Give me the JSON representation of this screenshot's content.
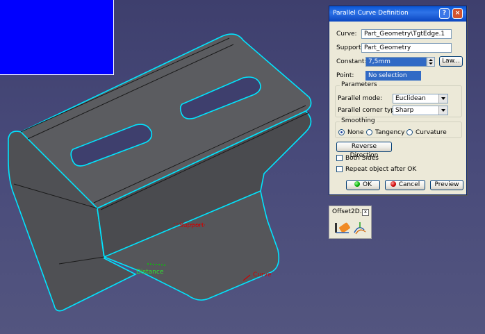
{
  "viewport": {
    "labels": {
      "distance": "Distance",
      "curve": "Curve",
      "support": "Support"
    },
    "colors": {
      "background": "#484a7a",
      "part_fill": "#5a5a5e",
      "edge_highlight": "#00e5ff",
      "compass": "#0000ff"
    }
  },
  "dialog": {
    "title": "Parallel Curve Definition",
    "help_label": "?",
    "close_label": "×",
    "curve": {
      "label": "Curve:",
      "value": "Part_Geometry\\TgtEdge.1"
    },
    "support": {
      "label": "Support:",
      "value": "Part_Geometry"
    },
    "constant": {
      "label": "Constant:",
      "value": "7,5mm",
      "law_button": "Law..."
    },
    "point": {
      "label": "Point:",
      "value": "No selection"
    },
    "parameters": {
      "legend": "Parameters",
      "mode_label": "Parallel mode:",
      "mode_value": "Euclidean",
      "corner_label": "Parallel corner type:",
      "corner_value": "Sharp"
    },
    "smoothing": {
      "legend": "Smoothing",
      "options": [
        "None",
        "Tangency",
        "Curvature"
      ],
      "selected": "None"
    },
    "reverse_button": "Reverse Direction",
    "both_sides": {
      "label": "Both Sides",
      "checked": false
    },
    "repeat": {
      "label": "Repeat object after OK",
      "checked": false
    },
    "buttons": {
      "ok": "OK",
      "cancel": "Cancel",
      "preview": "Preview"
    }
  },
  "toolbar": {
    "title": "Offset2D...",
    "close_label": "x",
    "icons": [
      "offset-edge-icon",
      "parallel-curve-icon"
    ]
  }
}
